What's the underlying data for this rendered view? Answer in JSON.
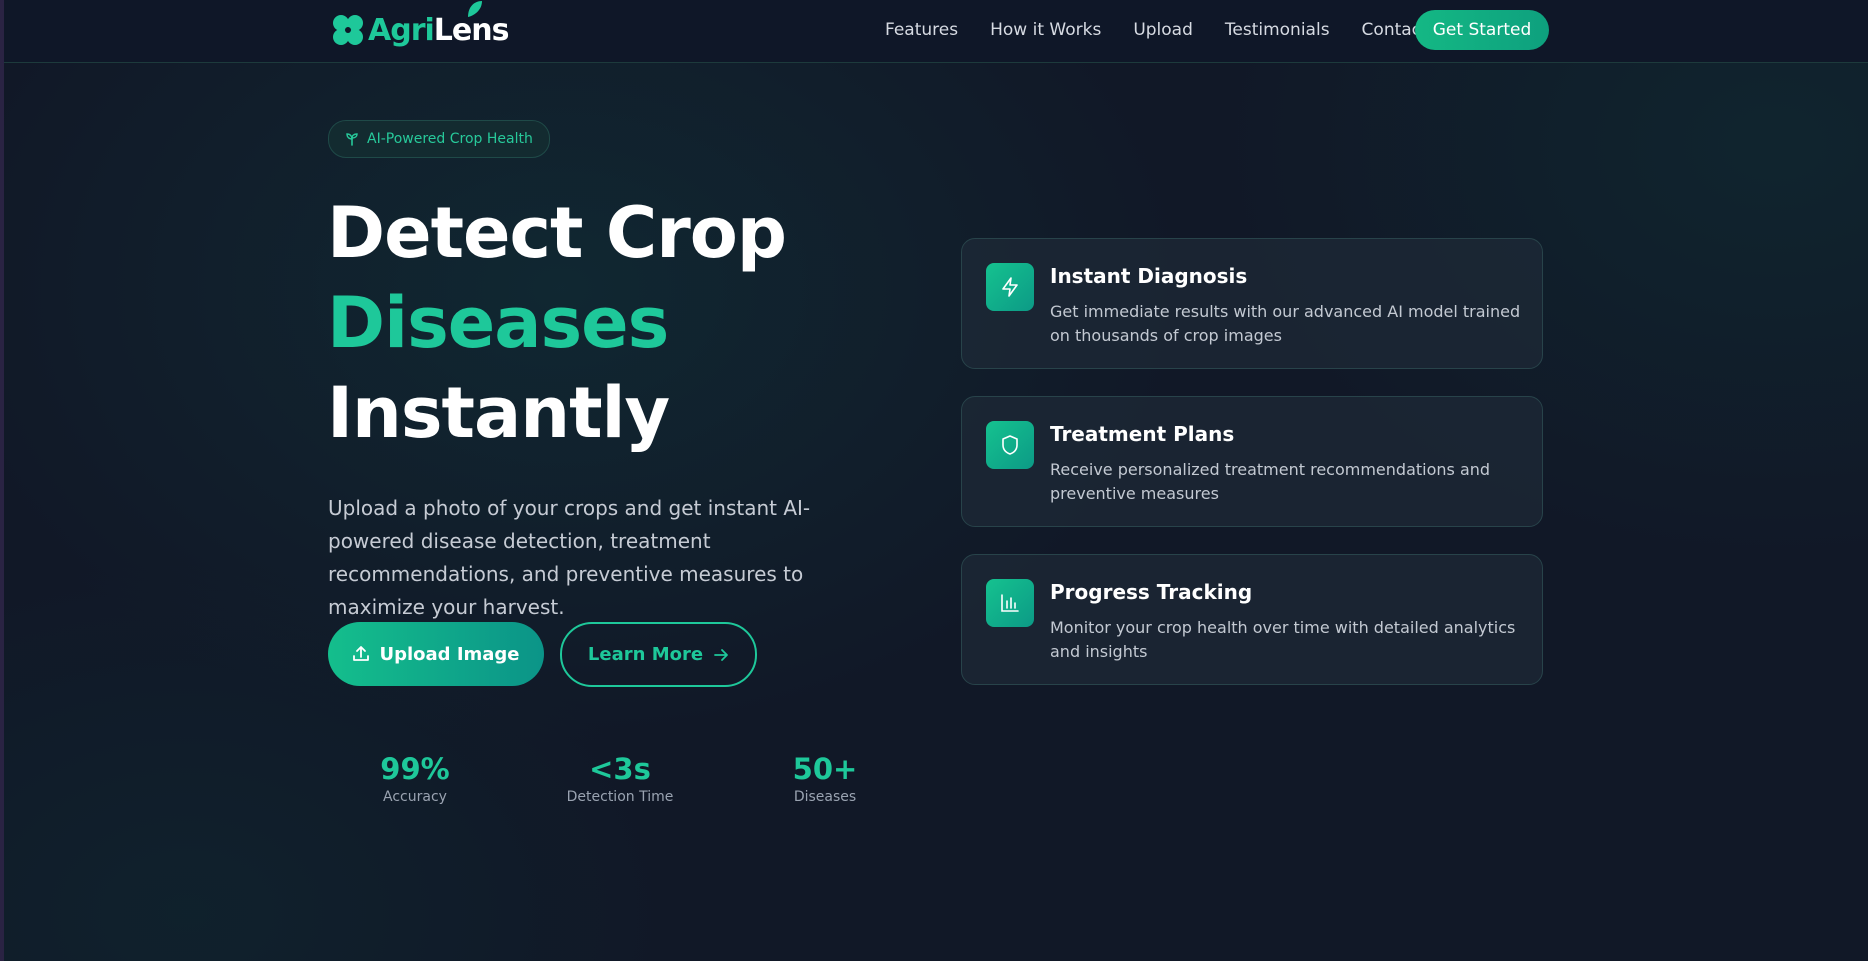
{
  "brand": {
    "name_part1": "Agri",
    "name_part2": "Lens"
  },
  "nav": {
    "links": [
      "Features",
      "How it Works",
      "Upload",
      "Testimonials",
      "Contact"
    ],
    "cta": "Get Started"
  },
  "hero": {
    "badge": "AI-Powered Crop Health",
    "headline_line1": "Detect Crop",
    "headline_line2": "Diseases",
    "headline_line3": "Instantly",
    "subtext": "Upload a photo of your crops and get instant AI-powered disease detection, treatment recommendations, and preventive measures to maximize your harvest.",
    "primary_button": "Upload Image",
    "secondary_button": "Learn More"
  },
  "stats": [
    {
      "value": "99%",
      "label": "Accuracy"
    },
    {
      "value": "<3s",
      "label": "Detection Time"
    },
    {
      "value": "50+",
      "label": "Diseases"
    }
  ],
  "features": [
    {
      "icon": "lightning-icon",
      "title": "Instant Diagnosis",
      "description": "Get immediate results with our advanced AI model trained on thousands of crop images"
    },
    {
      "icon": "shield-icon",
      "title": "Treatment Plans",
      "description": "Receive personalized treatment recommendations and preventive measures"
    },
    {
      "icon": "bar-chart-icon",
      "title": "Progress Tracking",
      "description": "Monitor your crop health over time with detailed analytics and insights"
    }
  ],
  "colors": {
    "accent": "#1ec89a",
    "background": "#111827",
    "nav_background": "#0f1728"
  }
}
